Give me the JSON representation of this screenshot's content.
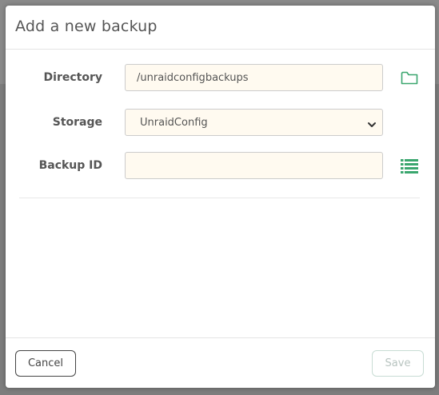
{
  "modal": {
    "title": "Add a new backup"
  },
  "form": {
    "directory": {
      "label": "Directory",
      "value": "/unraidconfigbackups",
      "icon": "folder-icon"
    },
    "storage": {
      "label": "Storage",
      "selected": "UnraidConfig",
      "options": [
        "UnraidConfig"
      ]
    },
    "backup_id": {
      "label": "Backup ID",
      "value": "",
      "placeholder": "",
      "icon": "list-icon"
    }
  },
  "footer": {
    "cancel_label": "Cancel",
    "save_label": "Save"
  },
  "colors": {
    "accent_icon": "#3aa66e",
    "input_background": "#fffaf0",
    "save_disabled_text": "#b8c4c0"
  }
}
